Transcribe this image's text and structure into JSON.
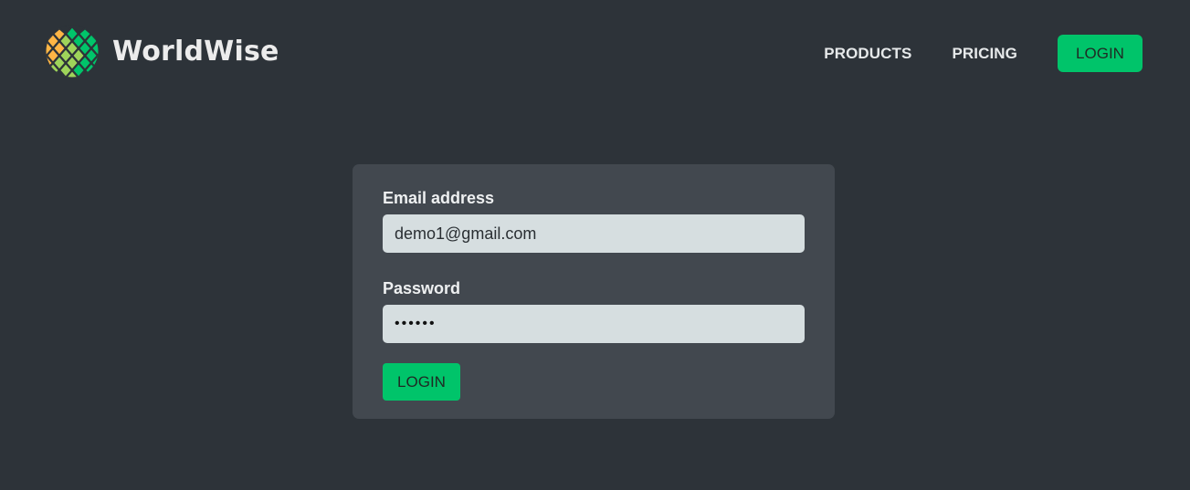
{
  "brand": {
    "name": "WorldWise",
    "logo_icon": "globe-hexagon-icon",
    "colors": {
      "green": "#00c46a",
      "light_green": "#9ed45a",
      "orange": "#ffb545"
    }
  },
  "nav": {
    "links": [
      {
        "label": "PRODUCTS"
      },
      {
        "label": "PRICING"
      }
    ],
    "login_label": "LOGIN"
  },
  "form": {
    "email_label": "Email address",
    "email_value": "demo1@gmail.com",
    "password_label": "Password",
    "password_value": "qwerty",
    "submit_label": "LOGIN"
  },
  "theme": {
    "background": "#2d3339",
    "card": "#42484f",
    "input": "#d6dee0",
    "accent": "#00c46a"
  }
}
